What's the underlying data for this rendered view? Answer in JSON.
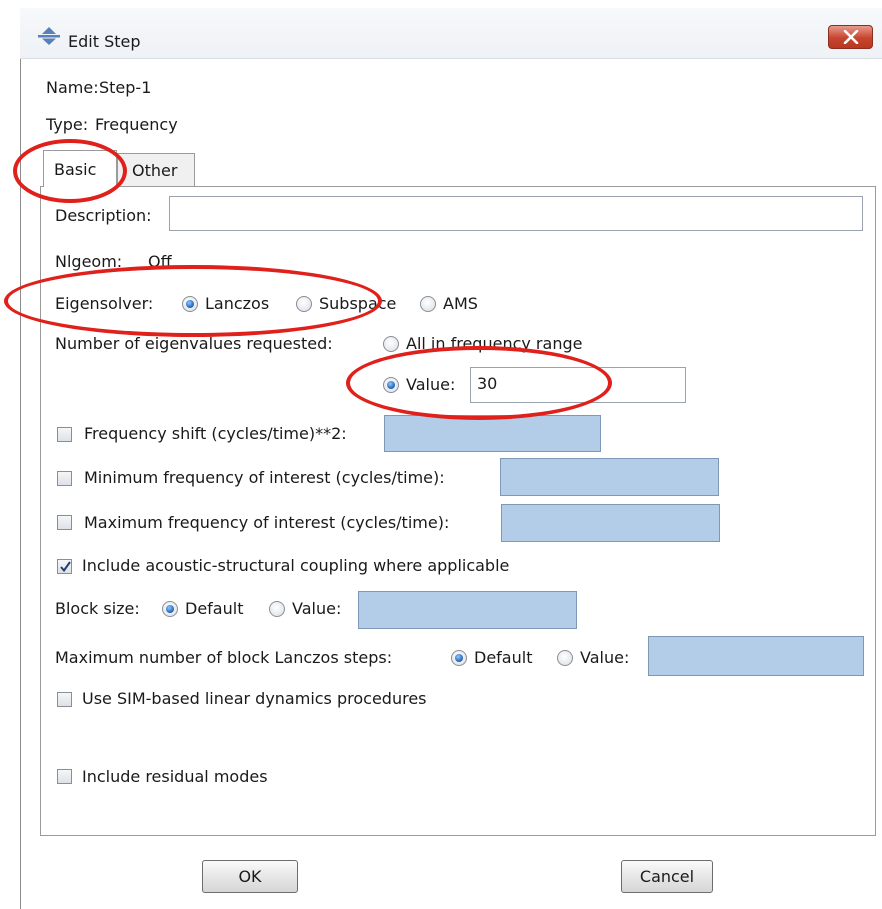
{
  "window": {
    "title": "Edit Step"
  },
  "header": {
    "name_label": "Name:",
    "name_value": "Step-1",
    "type_label": "Type:",
    "type_value": "Frequency"
  },
  "tabs": [
    {
      "label": "Basic",
      "active": true
    },
    {
      "label": "Other",
      "active": false
    }
  ],
  "form": {
    "description_label": "Description:",
    "description_value": "",
    "nlgeom_label": "Nlgeom:",
    "nlgeom_value": "Off",
    "eigensolver_label": "Eigensolver:",
    "eigensolver_options": [
      "Lanczos",
      "Subspace",
      "AMS"
    ],
    "eigensolver_selected": "Lanczos",
    "num_eigen_label": "Number of eigenvalues requested:",
    "num_eigen_option_all": "All in frequency range",
    "num_eigen_option_value": "Value:",
    "num_eigen_value": "30",
    "freq_shift_label": "Frequency shift (cycles/time)**2:",
    "min_freq_label": "Minimum frequency of interest (cycles/time):",
    "max_freq_label": "Maximum frequency of interest (cycles/time):",
    "acoustic_label": "Include acoustic-structural coupling where applicable",
    "acoustic_checked": true,
    "block_size_label": "Block size:",
    "block_size_default": "Default",
    "block_size_value": "Value:",
    "max_block_label": "Maximum number of block Lanczos steps:",
    "max_block_default": "Default",
    "max_block_value": "Value:",
    "sim_label": "Use SIM-based linear dynamics procedures",
    "residual_label": "Include residual modes"
  },
  "buttons": {
    "ok": "OK",
    "cancel": "Cancel"
  },
  "colors": {
    "annotation": "#e0201b",
    "field_blue": "#b3cce8",
    "close_red": "#c6452f"
  }
}
